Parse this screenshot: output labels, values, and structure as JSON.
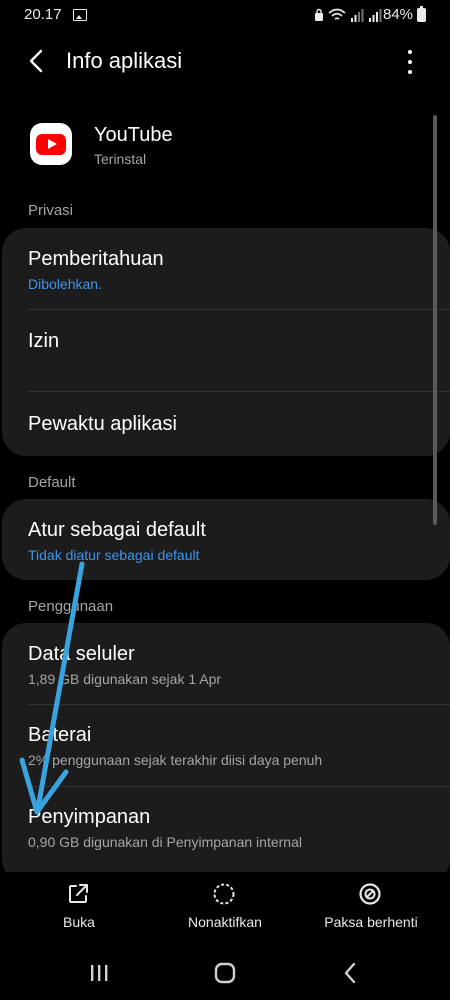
{
  "status_bar": {
    "time": "20.17",
    "battery": "84%",
    "icons": [
      "image-icon",
      "lock-icon",
      "wifi-icon",
      "signal-icon",
      "signal-icon",
      "battery-icon"
    ]
  },
  "header": {
    "title": "Info aplikasi"
  },
  "app": {
    "name": "YouTube",
    "status": "Terinstal"
  },
  "sections": {
    "privacy": {
      "label": "Privasi",
      "items": [
        {
          "title": "Pemberitahuan",
          "subtitle": "Dibolehkan."
        },
        {
          "title": "Izin"
        },
        {
          "title": "Pewaktu aplikasi"
        }
      ]
    },
    "default": {
      "label": "Default",
      "items": [
        {
          "title": "Atur sebagai default",
          "subtitle": "Tidak diatur sebagai default"
        }
      ]
    },
    "usage": {
      "label": "Penggunaan",
      "items": [
        {
          "title": "Data seluler",
          "subtitle": "1,89 GB digunakan sejak 1 Apr"
        },
        {
          "title": "Baterai",
          "subtitle": "2% penggunaan sejak terakhir diisi daya penuh"
        },
        {
          "title": "Penyimpanan",
          "subtitle": "0,90 GB digunakan di Penyimpanan internal"
        }
      ]
    }
  },
  "bottom_actions": [
    {
      "label": "Buka",
      "icon": "open-external-icon"
    },
    {
      "label": "Nonaktifkan",
      "icon": "disable-icon"
    },
    {
      "label": "Paksa berhenti",
      "icon": "force-stop-icon"
    }
  ],
  "colors": {
    "background": "#000000",
    "card": "#1c1c1c",
    "accent_blue": "#3e95ea",
    "annotation_arrow": "#3aa3df",
    "youtube_red": "#ff0000"
  }
}
